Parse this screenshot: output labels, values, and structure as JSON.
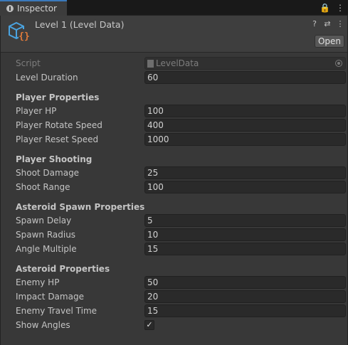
{
  "tab": {
    "label": "Inspector",
    "tools": [
      "🔒",
      "⋮"
    ]
  },
  "header": {
    "title": "Level 1 (Level Data)",
    "tools": [
      "?",
      "⇄",
      "⋮"
    ],
    "open_label": "Open"
  },
  "script": {
    "label": "Script",
    "value": "LevelData"
  },
  "level_duration": {
    "label": "Level Duration",
    "value": "60"
  },
  "player_properties": {
    "title": "Player Properties",
    "hp": {
      "label": "Player HP",
      "value": "100"
    },
    "rotate_speed": {
      "label": "Player Rotate Speed",
      "value": "400"
    },
    "reset_speed": {
      "label": "Player Reset Speed",
      "value": "1000"
    }
  },
  "player_shooting": {
    "title": "Player Shooting",
    "damage": {
      "label": "Shoot Damage",
      "value": "25"
    },
    "range": {
      "label": "Shoot Range",
      "value": "100"
    }
  },
  "asteroid_spawn": {
    "title": "Asteroid Spawn Properties",
    "delay": {
      "label": "Spawn Delay",
      "value": "5"
    },
    "radius": {
      "label": "Spawn Radius",
      "value": "10"
    },
    "angle_multiple": {
      "label": "Angle Multiple",
      "value": "15"
    }
  },
  "asteroid_properties": {
    "title": "Asteroid Properties",
    "enemy_hp": {
      "label": "Enemy HP",
      "value": "50"
    },
    "impact_damage": {
      "label": "Impact Damage",
      "value": "20"
    },
    "travel_time": {
      "label": "Enemy Travel Time",
      "value": "15"
    },
    "show_angles": {
      "label": "Show Angles",
      "checked": true
    }
  },
  "colors": {
    "accent": "#3a79bb",
    "asset_icon_blue": "#4aa3e0",
    "asset_icon_orange": "#e07a3a"
  }
}
